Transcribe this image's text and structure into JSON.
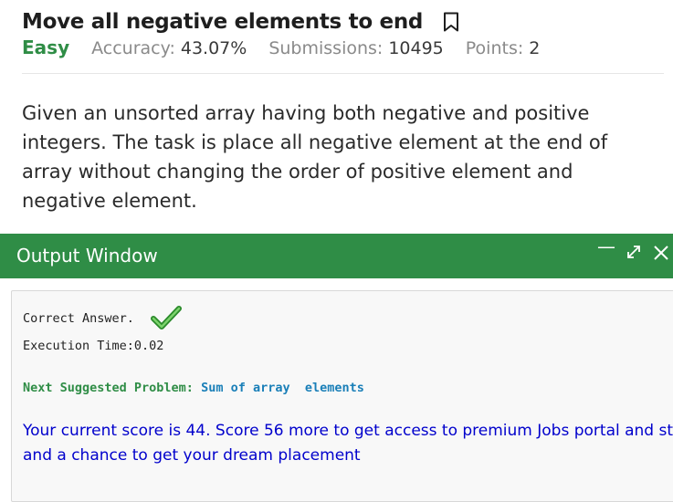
{
  "problem": {
    "title": "Move all negative elements to end",
    "difficulty": "Easy",
    "accuracy_label": "Accuracy:",
    "accuracy_value": "43.07%",
    "submissions_label": "Submissions:",
    "submissions_value": "10495",
    "points_label": "Points:",
    "points_value": "2",
    "description": "Given an unsorted array having both negative and positive integers. The task is place all negative element at the end of array without changing the order of positive element and negative element."
  },
  "output_window": {
    "title": "Output Window",
    "minimize_icon": "—",
    "expand_icon": "⤢",
    "close_icon": "✕",
    "correct_text": "Correct Answer.",
    "execution_time": "Execution Time:0.02",
    "next_label": "Next Suggested Problem: ",
    "next_link": "Sum of array  elements",
    "score_line1": "Your current score is 44. Score 56 more to get access to premium Jobs portal and st",
    "score_line2": "and a chance to get your dream placement"
  },
  "colors": {
    "accent_green": "#2f8d46",
    "link_blue": "#1a7fb8",
    "score_blue": "#0000cc"
  },
  "icons": [
    "bookmark-icon",
    "minimize-icon",
    "expand-icon",
    "close-icon",
    "checkmark-icon"
  ]
}
